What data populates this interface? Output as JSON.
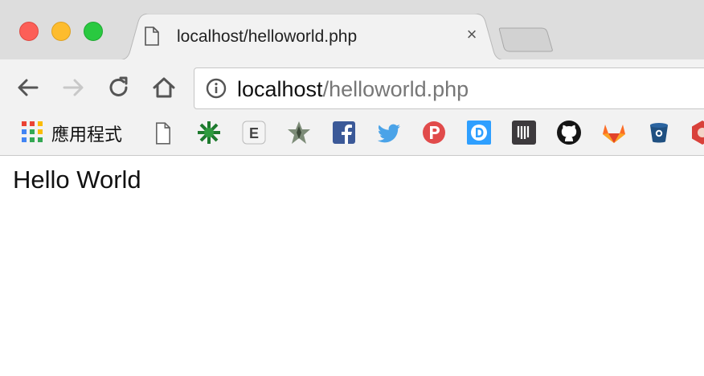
{
  "window": {
    "controls": [
      "close",
      "minimize",
      "zoom"
    ],
    "colors": {
      "close": "#fc5f57",
      "minimize": "#fdbc2e",
      "zoom": "#29c940"
    }
  },
  "tab": {
    "title": "localhost/helloworld.php",
    "close_glyph": "×",
    "icon": "document-icon"
  },
  "toolbar": {
    "back_icon": "back-arrow-icon",
    "forward_icon": "forward-arrow-icon",
    "reload_icon": "reload-icon",
    "home_icon": "home-icon",
    "url_host": "localhost",
    "url_path": "/helloworld.php",
    "info_icon": "info-icon"
  },
  "bookmarks": {
    "apps_label": "應用程式",
    "items": [
      "page-icon",
      "green-asterisk-icon",
      "evernote-e-icon",
      "star-app-icon",
      "facebook-icon",
      "twitter-icon",
      "producthunt-p-icon",
      "disqus-d-icon",
      "intercom-icon",
      "github-icon",
      "gitlab-icon",
      "bitbucket-icon",
      "red-hexagon-icon"
    ]
  },
  "page": {
    "body_text": "Hello World"
  }
}
